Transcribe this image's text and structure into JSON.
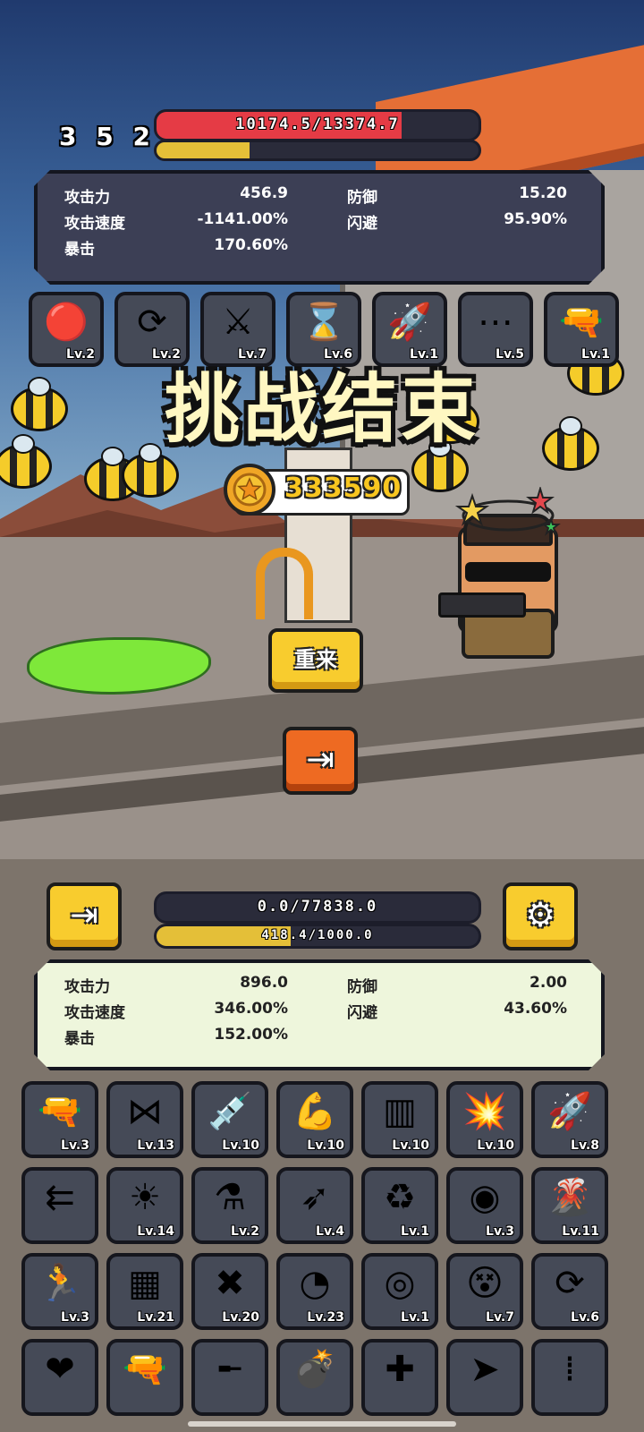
{
  "enemy": {
    "level": "3 5 2",
    "hp_text": "10174.5/13374.7",
    "hp_fraction": 0.761,
    "secondary_fraction": 0.29,
    "stats": {
      "attack_label": "攻击力",
      "attack_value": "456.9",
      "defense_label": "防御",
      "defense_value": "15.20",
      "speed_label": "攻击速度",
      "speed_value": "-1141.00%",
      "dodge_label": "闪避",
      "dodge_value": "95.90%",
      "crit_label": "暴击",
      "crit_value": "170.60%"
    },
    "skills": [
      {
        "icon": "red-orb-icon",
        "glyph": "🔴",
        "level": "Lv.2"
      },
      {
        "icon": "cycle-bolt-icon",
        "glyph": "⟳",
        "level": "Lv.2"
      },
      {
        "icon": "crossed-swords-icon",
        "glyph": "⚔",
        "level": "Lv.7"
      },
      {
        "icon": "hourglass-icon",
        "glyph": "⌛",
        "level": "Lv.6"
      },
      {
        "icon": "bullet-icon",
        "glyph": "🚀",
        "level": "Lv.1"
      },
      {
        "icon": "path-dots-icon",
        "glyph": "⋯",
        "level": "Lv.5"
      },
      {
        "icon": "pistol-icon",
        "glyph": "🔫",
        "level": "Lv.1"
      }
    ]
  },
  "overlay": {
    "title": "挑战结束",
    "coins": "333590",
    "retry_label": "重来",
    "exit_glyph": "⇥"
  },
  "player": {
    "hp_text": "0.0/77838.0",
    "hp_fraction": 0.0,
    "xp_text": "418.4/1000.0",
    "xp_fraction": 0.418,
    "exit_glyph": "⇥",
    "settings_glyph": "⚙",
    "stats": {
      "attack_label": "攻击力",
      "attack_value": "896.0",
      "defense_label": "防御",
      "defense_value": "2.00",
      "speed_label": "攻击速度",
      "speed_value": "346.00%",
      "dodge_label": "闪避",
      "dodge_value": "43.60%",
      "crit_label": "暴击",
      "crit_value": "152.00%"
    },
    "skills": [
      {
        "icon": "shotgun-icon",
        "glyph": "🔫",
        "level": "Lv.3"
      },
      {
        "icon": "network-icon",
        "glyph": "⋈",
        "level": "Lv.13"
      },
      {
        "icon": "syringe-icon",
        "glyph": "💉",
        "level": "Lv.10"
      },
      {
        "icon": "muscle-icon",
        "glyph": "💪",
        "level": "Lv.10"
      },
      {
        "icon": "magazine-icon",
        "glyph": "▥",
        "level": "Lv.10"
      },
      {
        "icon": "explosion-icon",
        "glyph": "💥",
        "level": "Lv.10"
      },
      {
        "icon": "rocket-icon",
        "glyph": "🚀",
        "level": "Lv.8"
      },
      {
        "icon": "arrows-left-icon",
        "glyph": "⇇",
        "level": ""
      },
      {
        "icon": "sun-orb-icon",
        "glyph": "☀",
        "level": "Lv.14"
      },
      {
        "icon": "potion-icon",
        "glyph": "⚗",
        "level": "Lv.2"
      },
      {
        "icon": "missile-icon",
        "glyph": "➶",
        "level": "Lv.4"
      },
      {
        "icon": "recycle-arrows-icon",
        "glyph": "♻",
        "level": "Lv.1"
      },
      {
        "icon": "black-hole-icon",
        "glyph": "◉",
        "level": "Lv.3"
      },
      {
        "icon": "volcano-icon",
        "glyph": "🌋",
        "level": "Lv.11"
      },
      {
        "icon": "runner-icon",
        "glyph": "🏃",
        "level": "Lv.3"
      },
      {
        "icon": "battery-chart-icon",
        "glyph": "▦",
        "level": "Lv.21"
      },
      {
        "icon": "crossed-rocket-icon",
        "glyph": "✖",
        "level": "Lv.20"
      },
      {
        "icon": "speed-gauge-icon",
        "glyph": "◔",
        "level": "Lv.23"
      },
      {
        "icon": "target-icon",
        "glyph": "◎",
        "level": "Lv.1"
      },
      {
        "icon": "dizzy-face-icon",
        "glyph": "😵",
        "level": "Lv.7"
      },
      {
        "icon": "cycle-bolt-icon",
        "glyph": "⟳",
        "level": "Lv.6"
      },
      {
        "icon": "heart-plus-icon",
        "glyph": "❤",
        "level": ""
      },
      {
        "icon": "pistol-icon",
        "glyph": "🔫",
        "level": ""
      },
      {
        "icon": "shotgun-icon",
        "glyph": "╾",
        "level": ""
      },
      {
        "icon": "grenade-icon",
        "glyph": "💣",
        "level": ""
      },
      {
        "icon": "medkit-icon",
        "glyph": "✚",
        "level": ""
      },
      {
        "icon": "gold-bullet-icon",
        "glyph": "➤",
        "level": ""
      },
      {
        "icon": "ammo-icon",
        "glyph": "⁞",
        "level": ""
      }
    ]
  }
}
